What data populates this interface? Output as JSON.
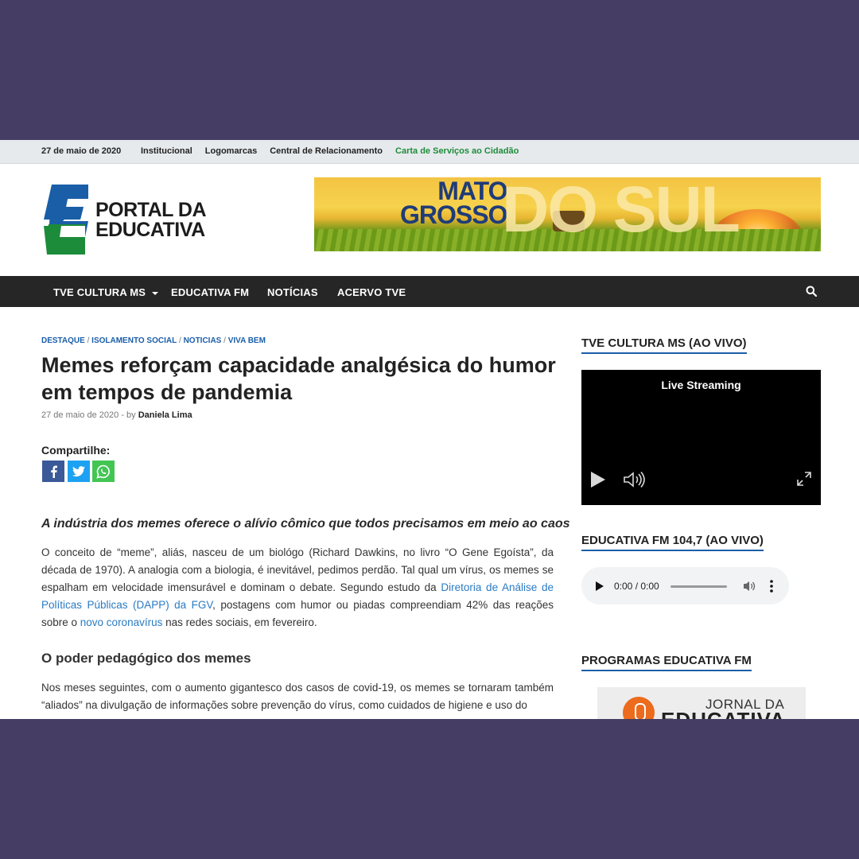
{
  "topbar": {
    "date": "27 de maio de 2020",
    "links": [
      "Institucional",
      "Logomarcas",
      "Central de Relacionamento"
    ],
    "highlight_link": "Carta de Serviços ao Cidadão",
    "highlight_color": "#1d8c3a"
  },
  "header": {
    "logo_line1": "PORTAL DA",
    "logo_line2": "EDUCATIVA",
    "banner_line1": "MATO",
    "banner_line2": "GROSSO",
    "banner_big": "DO SUL"
  },
  "nav": {
    "items": [
      "TVE CULTURA MS",
      "EDUCATIVA FM",
      "NOTÍCIAS",
      "ACERVO TVE"
    ],
    "search_icon": "search-icon"
  },
  "article": {
    "categories": [
      "DESTAQUE",
      "ISOLAMENTO SOCIAL",
      "NOTICIAS",
      "VIVA BEM"
    ],
    "title": "Memes reforçam capacidade analgésica do humor em tempos de pandemia",
    "date": "27 de maio de 2020",
    "by": "by",
    "author": "Daniela Lima",
    "share_label": "Compartilhe:",
    "lead": "A indústria dos memes oferece o alívio cômico que todos precisamos em meio ao caos",
    "p1": {
      "t1": "O conceito de “meme”, aliás, nasceu de um biológo (Richard Dawkins, no livro “O Gene Egoísta”, da década de 1970). A analogia com a biologia, é inevitável, pedimos perdão. Tal qual um vírus, os memes se espalham em velocidade imensurável e dominam o debate. Segundo estudo da ",
      "link1": "Diretoria de Análise de Políticas Públicas (DAPP) da FGV",
      "t2": ", postagens com humor ou piadas compreendiam 42% das reações sobre o ",
      "link2": "novo coronavírus",
      "t3": " nas redes sociais, em fevereiro."
    },
    "subheading": "O poder pedagógico dos memes",
    "p2": "Nos meses seguintes, com o aumento gigantesco dos casos de covid-19, os memes se tornaram também “aliados” na divulgação de informações sobre prevenção do vírus, como cuidados de higiene e uso do"
  },
  "sidebar": {
    "tv_title": "TVE CULTURA MS (AO VIVO)",
    "live_label": "Live Streaming",
    "fm_title": "EDUCATIVA FM 104,7 (AO VIVO)",
    "audio_time": "0:00 / 0:00",
    "programs_title": "PROGRAMAS EDUCATIVA FM",
    "program_line1": "JORNAL DA",
    "program_line2": "EDUCATIVA"
  },
  "colors": {
    "background": "#453d63",
    "nav": "#262626",
    "link": "#2a7bc4",
    "logo_blue": "#1a5ea8",
    "logo_green": "#1d8c3a"
  }
}
